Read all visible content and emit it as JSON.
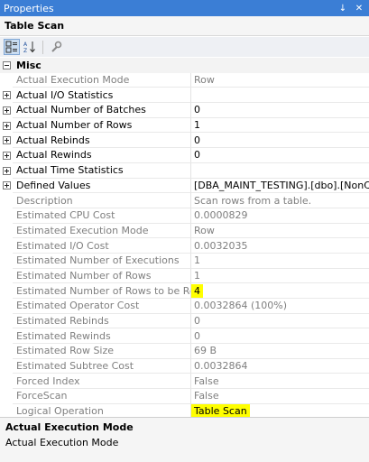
{
  "window": {
    "title": "Properties",
    "pin_glyph": "↓",
    "close_glyph": "✕"
  },
  "object_name": "Table Scan",
  "toolbar": {
    "icons": [
      "categorized-icon",
      "alphabetical-icon",
      "property-pages-icon"
    ]
  },
  "category": {
    "label": "Misc",
    "state": "expanded"
  },
  "properties": [
    {
      "name": "Actual Execution Mode",
      "value": "Row",
      "readonly": true,
      "expander": false
    },
    {
      "name": "Actual I/O Statistics",
      "value": "",
      "readonly": false,
      "expander": true
    },
    {
      "name": "Actual Number of Batches",
      "value": "0",
      "readonly": false,
      "expander": true
    },
    {
      "name": "Actual Number of Rows",
      "value": "1",
      "readonly": false,
      "expander": true
    },
    {
      "name": "Actual Rebinds",
      "value": "0",
      "readonly": false,
      "expander": true
    },
    {
      "name": "Actual Rewinds",
      "value": "0",
      "readonly": false,
      "expander": true
    },
    {
      "name": "Actual Time Statistics",
      "value": "",
      "readonly": false,
      "expander": true
    },
    {
      "name": "Defined Values",
      "value": "[DBA_MAINT_TESTING].[dbo].[NonClustered",
      "readonly": false,
      "expander": true
    },
    {
      "name": "Description",
      "value": "Scan rows from a table.",
      "readonly": true,
      "expander": false
    },
    {
      "name": "Estimated CPU Cost",
      "value": "0.0000829",
      "readonly": true,
      "expander": false
    },
    {
      "name": "Estimated Execution Mode",
      "value": "Row",
      "readonly": true,
      "expander": false
    },
    {
      "name": "Estimated I/O Cost",
      "value": "0.0032035",
      "readonly": true,
      "expander": false
    },
    {
      "name": "Estimated Number of Executions",
      "value": "1",
      "readonly": true,
      "expander": false
    },
    {
      "name": "Estimated Number of Rows",
      "value": "1",
      "readonly": true,
      "expander": false
    },
    {
      "name": "Estimated Number of Rows to be Read",
      "value": "4",
      "readonly": true,
      "expander": false,
      "highlight": true
    },
    {
      "name": "Estimated Operator Cost",
      "value": "0.0032864 (100%)",
      "readonly": true,
      "expander": false
    },
    {
      "name": "Estimated Rebinds",
      "value": "0",
      "readonly": true,
      "expander": false
    },
    {
      "name": "Estimated Rewinds",
      "value": "0",
      "readonly": true,
      "expander": false
    },
    {
      "name": "Estimated Row Size",
      "value": "69 B",
      "readonly": true,
      "expander": false
    },
    {
      "name": "Estimated Subtree Cost",
      "value": "0.0032864",
      "readonly": true,
      "expander": false
    },
    {
      "name": "Forced Index",
      "value": "False",
      "readonly": true,
      "expander": false
    },
    {
      "name": "ForceScan",
      "value": "False",
      "readonly": true,
      "expander": false
    },
    {
      "name": "Logical Operation",
      "value": "Table Scan",
      "readonly": true,
      "expander": false,
      "highlight": true
    }
  ],
  "description_pane": {
    "title": "Actual Execution Mode",
    "text": "Actual Execution Mode"
  },
  "colors": {
    "title_bar": "#3b7ed5",
    "highlight": "#ffff00",
    "readonly_text": "#7f7f7f"
  }
}
